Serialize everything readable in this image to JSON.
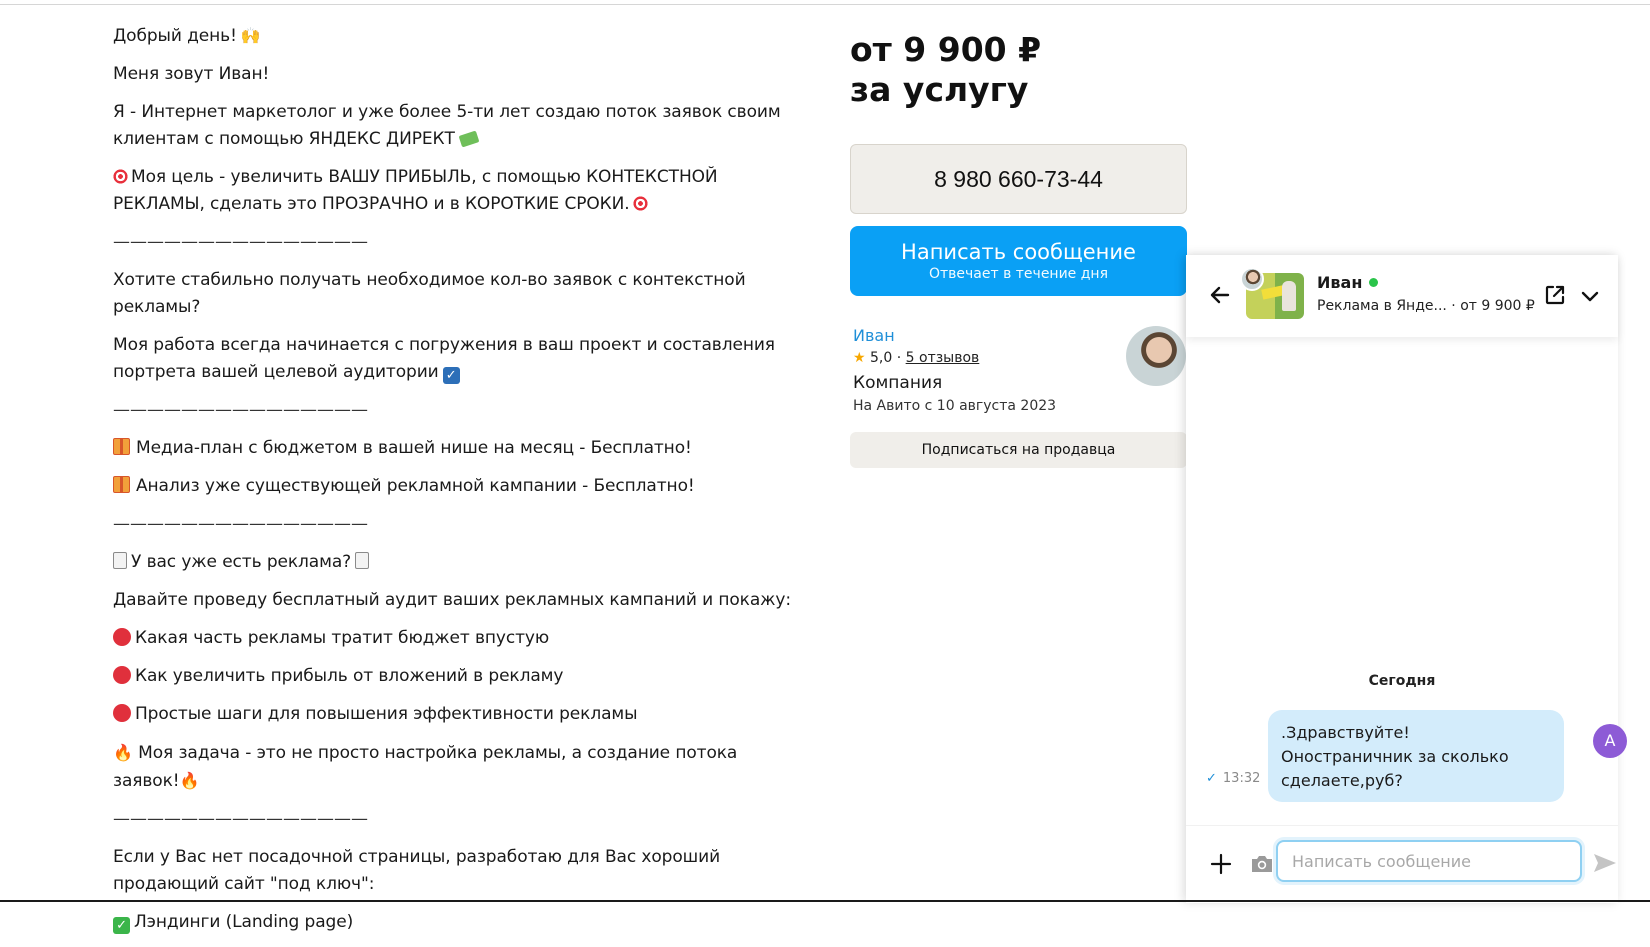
{
  "description": {
    "greeting": "Добрый день!",
    "intro": "Меня зовут Иван!",
    "about": "Я - Интернет маркетолог и уже более 5-ти лет создаю поток заявок своим клиентам с помощью ЯНДЕКС ДИРЕКТ",
    "goal": "Моя цель - увеличить ВАШУ ПРИБЫЛЬ, с помощью КОНТЕКСТНОЙ РЕКЛАМЫ, сделать это ПРОЗРАЧНО и в КОРОТКИЕ СРОКИ.",
    "divider": "———————————————",
    "question": "Хотите стабильно получать необходимое кол-во заявок с контекстной рекламы?",
    "process": "Моя работа всегда начинается с погружения в ваш проект и составления портрета вашей целевой аудитории",
    "bonus1": "Медиа-план с бюджетом в вашей нише на месяц - Бесплатно!",
    "bonus2": "Анализ уже существующей рекламной кампании - Бесплатно!",
    "ads_question": "У вас уже есть реклама?",
    "audit": "Давайте проведу бесплатный аудит ваших рекламных кампаний и покажу:",
    "point1": "Какая часть рекламы тратит бюджет впустую",
    "point2": "Как увеличить прибыль от вложений в рекламу",
    "point3": "Простые шаги для повышения эффективности рекламы",
    "task": "Моя задача - это не просто настройка рекламы, а создание потока заявок!",
    "landing_offer": "Если у Вас нет посадочной страницы, разработаю для Вас хороший продающий сайт \"под ключ\":",
    "landing_item": "Лэндинги (Landing page)"
  },
  "offer": {
    "price_line1": "от 9 900 ₽",
    "price_line2": "за услугу",
    "phone": "8 980 660-73-44",
    "message_button": "Написать сообщение",
    "message_button_sub": "Отвечает в течение дня",
    "subscribe_button": "Подписаться на продавца"
  },
  "seller": {
    "name": "Иван",
    "rating": "5,0",
    "rating_sep": "·",
    "reviews": "5 отзывов",
    "type": "Компания",
    "since": "На Авито с 10 августа 2023"
  },
  "chat": {
    "name": "Иван",
    "listing": "Реклама в Янде... · от 9 900 ₽",
    "date_separator": "Сегодня",
    "message_text": ".Здравствуйте!\nОностраничник за сколько сделаете,руб?",
    "message_time": "13:32",
    "user_initial": "А",
    "input_placeholder": "Написать сообщение",
    "online_color": "#2ac44a",
    "bubble_color": "#d3ecfb"
  },
  "icons": {
    "back": "arrow-left-icon",
    "open": "external-link-icon",
    "collapse": "chevron-down-icon",
    "attach": "plus-icon",
    "camera": "camera-icon",
    "send": "send-icon"
  },
  "colors": {
    "accent": "#0aa0f5",
    "link": "#1f8fd8",
    "star": "#f7a700",
    "user_avatar": "#8d5bd6"
  }
}
